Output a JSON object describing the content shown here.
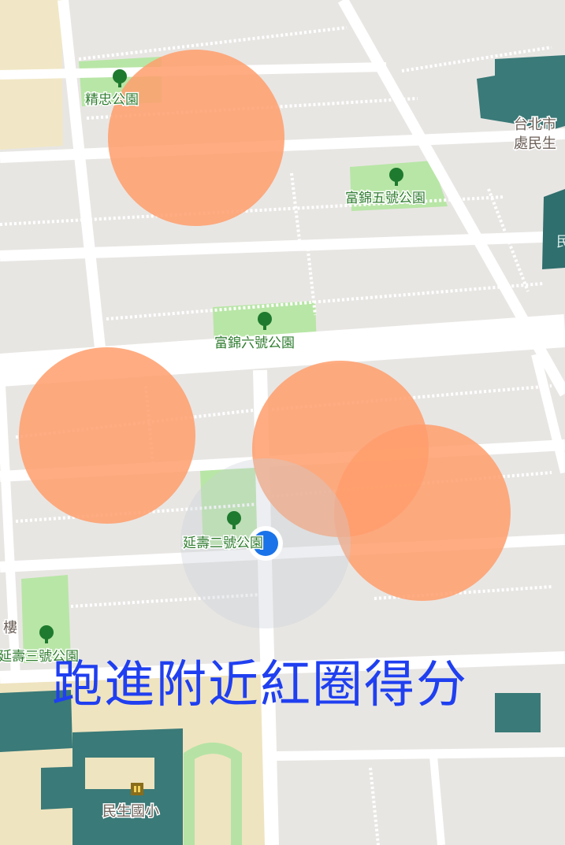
{
  "map": {
    "parks": [
      {
        "label": "精忠公園"
      },
      {
        "label": "富錦五號公園"
      },
      {
        "label": "富錦六號公園"
      },
      {
        "label": "延壽二號公園"
      },
      {
        "label": "延壽三號公園"
      }
    ],
    "pois": {
      "office_line1": "台北市",
      "office_line2": "處民生",
      "building_partial": "樓",
      "school": "民生國小",
      "east_edge_char": "民"
    },
    "target_zone_color": "#ff9d6c",
    "user_dot_color": "#1a73e8",
    "icons": [
      "tree-icon",
      "school-icon",
      "user-location-dot"
    ]
  },
  "overlay": {
    "instruction": "跑進附近紅圈得分"
  }
}
